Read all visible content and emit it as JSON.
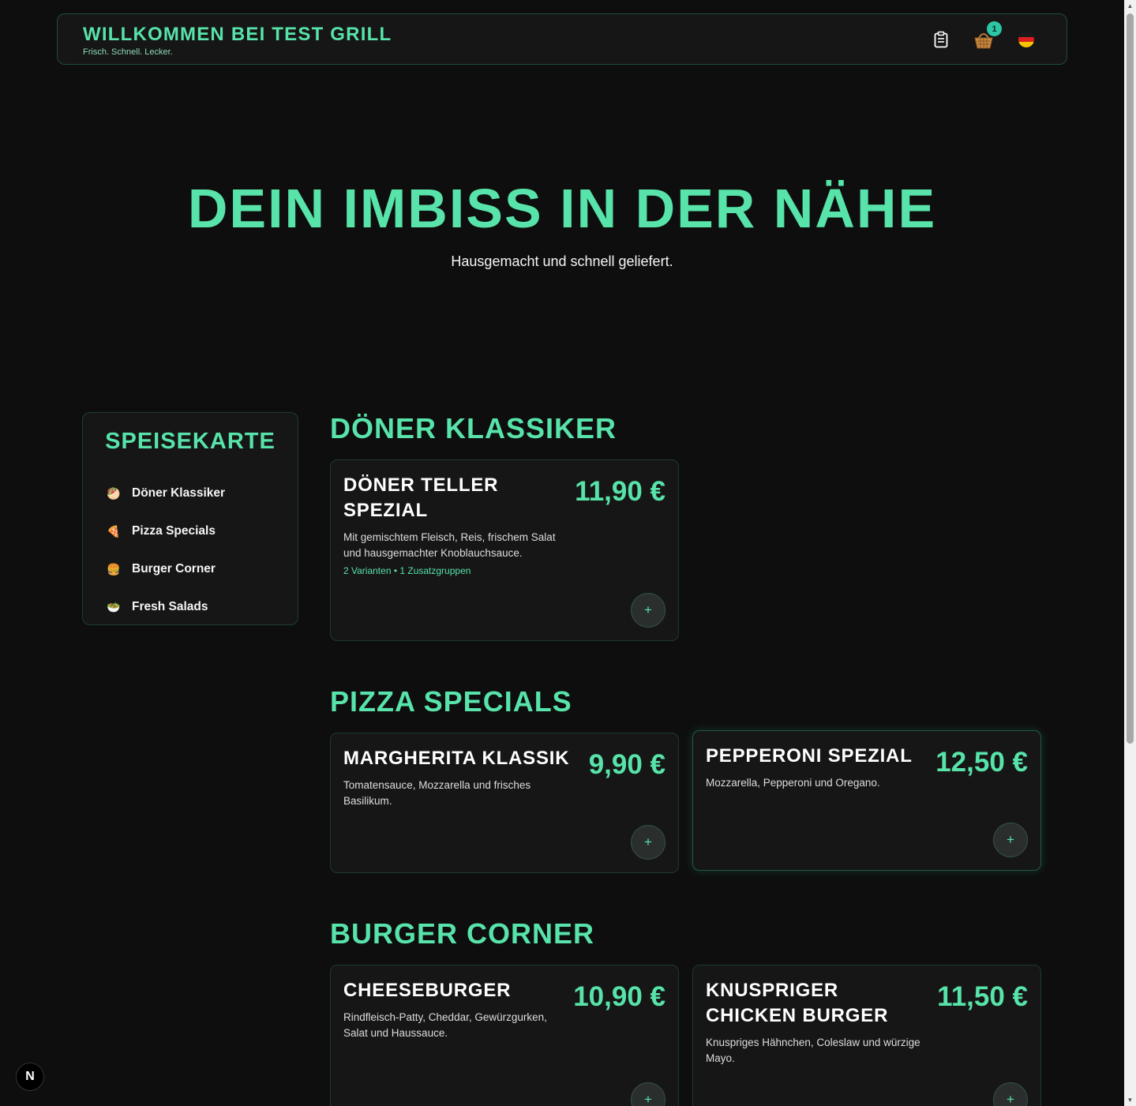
{
  "header": {
    "title": "WILLKOMMEN BEI TEST GRILL",
    "tagline": "Frisch. Schnell. Lecker.",
    "icons": [
      "clipboard-icon",
      "basket-icon",
      "german-flag-icon"
    ],
    "cart_count": "1"
  },
  "hero": {
    "title": "DEIN IMBISS IN DER NÄHE",
    "subtitle": "Hausgemacht und schnell geliefert."
  },
  "sidebar": {
    "title": "SPEISEKARTE",
    "items": [
      {
        "emoji": "🥙",
        "label": "Döner Klassiker"
      },
      {
        "emoji": "🍕",
        "label": "Pizza Specials"
      },
      {
        "emoji": "🍔",
        "label": "Burger Corner"
      },
      {
        "emoji": "🥗",
        "label": "Fresh Salads"
      }
    ]
  },
  "sections": [
    {
      "title": "DÖNER KLASSIKER",
      "items": [
        {
          "name": "DÖNER TELLER SPEZIAL",
          "price": "11,90 €",
          "description": "Mit gemischtem Fleisch, Reis, frischem Salat und hausgemachter Knoblauchsauce.",
          "meta": "2 Varianten • 1 Zusatzgruppen",
          "add": "+"
        }
      ]
    },
    {
      "title": "PIZZA SPECIALS",
      "items": [
        {
          "name": "MARGHERITA KLASSIK",
          "price": "9,90 €",
          "description": "Tomatensauce, Mozzarella und frisches Basilikum.",
          "add": "+"
        },
        {
          "name": "PEPPERONI SPEZIAL",
          "price": "12,50 €",
          "description": "Mozzarella, Pepperoni und Oregano.",
          "add": "+"
        }
      ]
    },
    {
      "title": "BURGER CORNER",
      "items": [
        {
          "name": "CHEESEBURGER",
          "price": "10,90 €",
          "description": "Rindfleisch-Patty, Cheddar, Gewürzgurken, Salat und Haussauce.",
          "add": "+"
        },
        {
          "name": "KNUSPRIGER CHICKEN BURGER",
          "price": "11,50 €",
          "description": "Knuspriges Hähnchen, Coleslaw und würzige Mayo.",
          "add": "+"
        }
      ]
    }
  ],
  "next_badge": "N",
  "colors": {
    "accent": "#57e3a9",
    "background": "#0e0e0e",
    "card": "#161616",
    "badge": "#2cc5a5"
  }
}
